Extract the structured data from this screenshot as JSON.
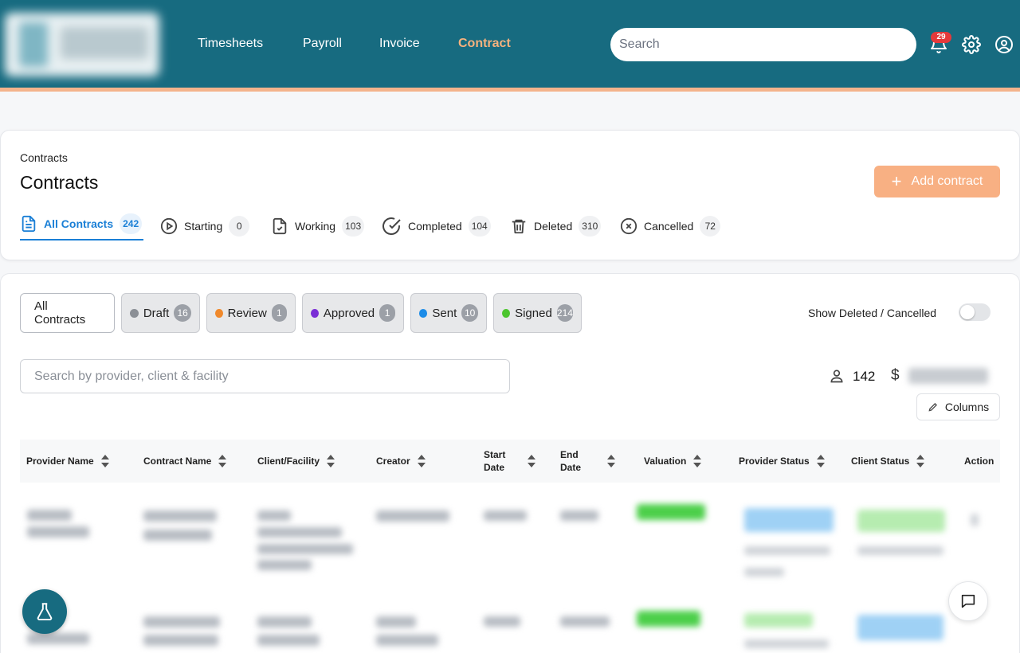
{
  "nav": {
    "items": [
      {
        "label": "Timesheets"
      },
      {
        "label": "Payroll"
      },
      {
        "label": "Invoice"
      },
      {
        "label": "Contract"
      }
    ],
    "search_placeholder": "Search",
    "notification_count": "29"
  },
  "header": {
    "breadcrumb": "Contracts",
    "title": "Contracts",
    "add_button": "Add contract",
    "tabs": [
      {
        "label": "All Contracts",
        "count": "242"
      },
      {
        "label": "Starting",
        "count": "0"
      },
      {
        "label": "Working",
        "count": "103"
      },
      {
        "label": "Completed",
        "count": "104"
      },
      {
        "label": "Deleted",
        "count": "310"
      },
      {
        "label": "Cancelled",
        "count": "72"
      }
    ]
  },
  "filters": {
    "all_label": "All Contracts",
    "chips": [
      {
        "label": "Draft",
        "count": "16",
        "color": "#8b8f96"
      },
      {
        "label": "Review",
        "count": "1",
        "color": "#f0892c"
      },
      {
        "label": "Approved",
        "count": "1",
        "color": "#7a2ed6"
      },
      {
        "label": "Sent",
        "count": "10",
        "color": "#1c8ce8"
      },
      {
        "label": "Signed",
        "count": "214",
        "color": "#4cc52e"
      }
    ],
    "toggle_label": "Show Deleted / Cancelled",
    "search_placeholder": "Search by provider, client & facility",
    "provider_count": "142",
    "currency_symbol": "$",
    "columns_button": "Columns"
  },
  "table": {
    "columns": [
      "Provider Name",
      "Contract Name",
      "Client/Facility",
      "Creator",
      "Start Date",
      "End Date",
      "Valuation",
      "Provider Status",
      "Client Status",
      "Action"
    ]
  },
  "colors": {
    "brand": "#176b80",
    "accent": "#f6b27e",
    "active_tab": "#1a7fd6"
  }
}
